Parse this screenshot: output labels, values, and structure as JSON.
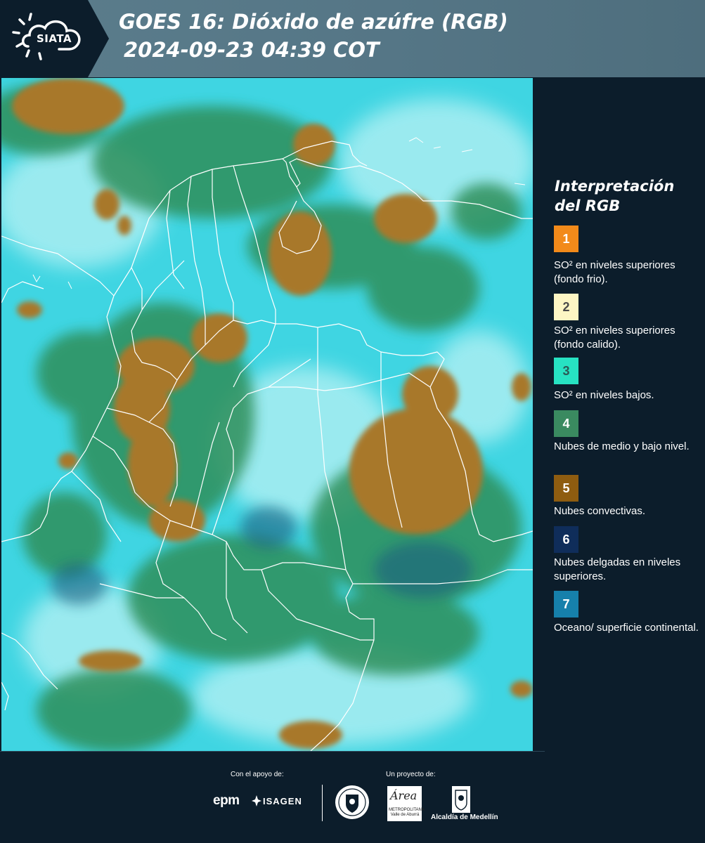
{
  "header": {
    "logo_text": "SIATA",
    "title_line1": "GOES 16: Dióxido de azúfre (RGB)",
    "title_line2": "2024-09-23 04:39 COT"
  },
  "legend": {
    "title": "Interpretación del RGB",
    "items": [
      {
        "number": "1",
        "color": "#f28a1a",
        "number_color": "#ffffff",
        "text": "SO² en niveles superiores (fondo frio)."
      },
      {
        "number": "2",
        "color": "#fdf6c4",
        "number_color": "#4a4a4a",
        "text": "SO² en niveles superiores (fondo calido)."
      },
      {
        "number": "3",
        "color": "#27e2c2",
        "number_color": "#2a5a55",
        "text": "SO² en niveles bajos."
      },
      {
        "number": "4",
        "color": "#3a8a60",
        "number_color": "#ffffff",
        "text": "Nubes de medio y bajo nivel."
      },
      {
        "number": "5",
        "color": "#8e5c10",
        "number_color": "#ffffff",
        "text": "Nubes convectivas."
      },
      {
        "number": "6",
        "color": "#0f2d5a",
        "number_color": "#ffffff",
        "text": "Nubes delgadas en niveles superiores."
      },
      {
        "number": "7",
        "color": "#1680ab",
        "number_color": "#ffffff",
        "text": "Oceano/ superficie continental."
      }
    ]
  },
  "footer": {
    "support_label": "Con el apoyo de:",
    "project_label": "Un proyecto de:",
    "epm": "epm",
    "isagen": "ISAGEN",
    "area_script": "Área",
    "area_small": "METROPOLITANA Valle de Aburrá",
    "alcaldia": "Alcaldía de Medellín"
  },
  "colors": {
    "background": "#0c1d2b",
    "map_base": "#3fd5e2",
    "convective_cloud": "#a8782a",
    "mid_low_cloud": "#2f8f5a"
  }
}
